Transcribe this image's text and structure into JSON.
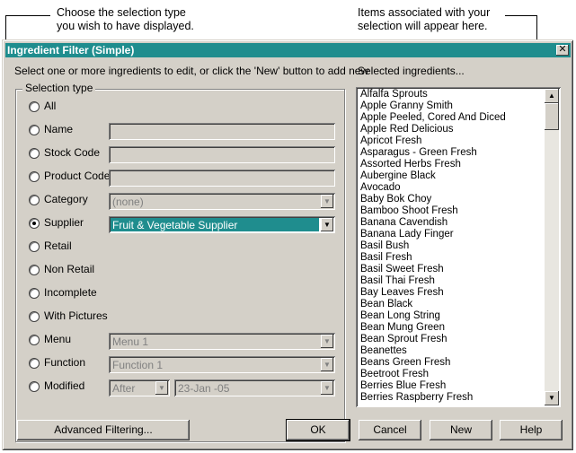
{
  "annotations": {
    "left_line1": "Choose the selection type",
    "left_line2": "you wish to have displayed.",
    "right_line1": "Items associated with your",
    "right_line2": "selection will appear here."
  },
  "dialog": {
    "title": "Ingredient Filter (Simple)",
    "close_glyph": "✕",
    "instruction": "Select one or more ingredients to edit, or click the 'New' button to add new",
    "selected_label": "Selected ingredients...",
    "group_label": "Selection type"
  },
  "selection_types": [
    {
      "label": "All",
      "selected": false
    },
    {
      "label": "Name",
      "selected": false
    },
    {
      "label": "Stock Code",
      "selected": false
    },
    {
      "label": "Product Code",
      "selected": false
    },
    {
      "label": "Category",
      "selected": false
    },
    {
      "label": "Supplier",
      "selected": true
    },
    {
      "label": "Retail",
      "selected": false
    },
    {
      "label": "Non Retail",
      "selected": false
    },
    {
      "label": "Incomplete",
      "selected": false
    },
    {
      "label": "With Pictures",
      "selected": false
    },
    {
      "label": "Menu",
      "selected": false
    },
    {
      "label": "Function",
      "selected": false
    },
    {
      "label": "Modified",
      "selected": false
    }
  ],
  "fields": {
    "name": "",
    "stock_code": "",
    "product_code": "",
    "category": "(none)",
    "supplier": "Fruit & Vegetable Supplier",
    "menu": "Menu 1",
    "function": "Function 1",
    "modified_op": "After",
    "modified_date": "23-Jan -05"
  },
  "ingredients": [
    "Alfalfa Sprouts",
    "Apple Granny Smith",
    "Apple Peeled, Cored And Diced",
    "Apple Red Delicious",
    "Apricot Fresh",
    "Asparagus - Green Fresh",
    "Assorted Herbs Fresh",
    "Aubergine Black",
    "Avocado",
    "Baby Bok Choy",
    "Bamboo Shoot Fresh",
    "Banana Cavendish",
    "Banana Lady Finger",
    "Basil Bush",
    "Basil Fresh",
    "Basil Sweet Fresh",
    "Basil Thai Fresh",
    "Bay Leaves Fresh",
    "Bean Black",
    "Bean Long String",
    "Bean Mung Green",
    "Bean Sprout Fresh",
    "Beanettes",
    "Beans Green Fresh",
    "Beetroot Fresh",
    "Berries Blue Fresh",
    "Berries Raspberry Fresh"
  ],
  "buttons": {
    "advanced": "Advanced Filtering...",
    "ok": "OK",
    "cancel": "Cancel",
    "new": "New",
    "help": "Help"
  },
  "colors": {
    "titlebar": "#1f8d8e",
    "selected_field": "#1f8d8e",
    "dialog_face": "#d4d0c8"
  },
  "icons": {
    "close": "close-icon",
    "dropdown": "chevron-down-icon",
    "scroll_up": "arrow-up-icon",
    "scroll_down": "arrow-down-icon"
  }
}
